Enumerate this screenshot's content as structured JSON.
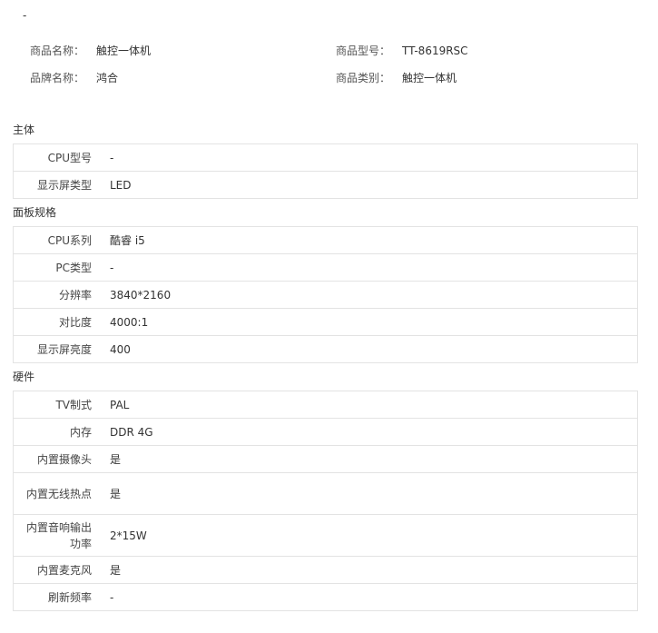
{
  "top_dash": "-",
  "summary": [
    {
      "label": "商品名称：",
      "value": "触控一体机"
    },
    {
      "label": "商品型号：",
      "value": "TT-8619RSC"
    },
    {
      "label": "品牌名称：",
      "value": "鸿合"
    },
    {
      "label": "商品类别：",
      "value": "触控一体机"
    }
  ],
  "sections": [
    {
      "title": "主体",
      "rows": [
        {
          "key": "CPU型号",
          "value": "-"
        },
        {
          "key": "显示屏类型",
          "value": "LED"
        }
      ]
    },
    {
      "title": "面板规格",
      "rows": [
        {
          "key": "CPU系列",
          "value": "酷睿 i5"
        },
        {
          "key": "PC类型",
          "value": "-"
        },
        {
          "key": "分辨率",
          "value": "3840*2160"
        },
        {
          "key": "对比度",
          "value": "4000:1"
        },
        {
          "key": "显示屏亮度",
          "value": "400"
        }
      ]
    },
    {
      "title": "硬件",
      "rows": [
        {
          "key": "TV制式",
          "value": "PAL"
        },
        {
          "key": "内存",
          "value": "DDR 4G"
        },
        {
          "key": "内置摄像头",
          "value": "是"
        },
        {
          "key": "内置无线热点",
          "value": "是"
        },
        {
          "key": "内置音响输出功率",
          "value": "2*15W"
        },
        {
          "key": "内置麦克风",
          "value": "是"
        },
        {
          "key": "刷新频率",
          "value": "-"
        }
      ]
    }
  ]
}
